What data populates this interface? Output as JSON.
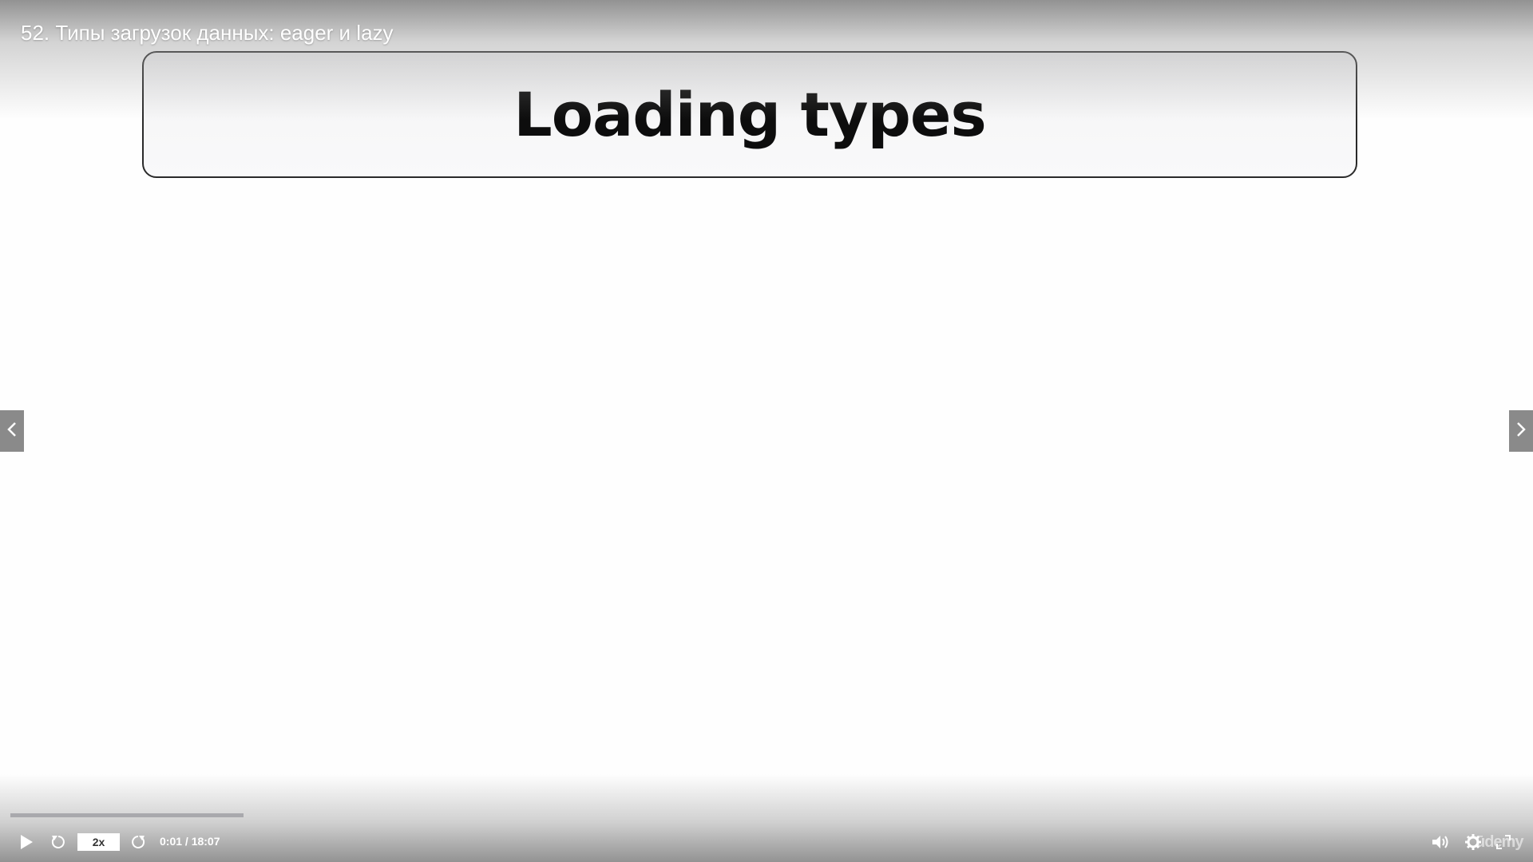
{
  "lecture": {
    "title": "52. Типы загрузок данных: eager и lazy"
  },
  "slide": {
    "title": "Loading types"
  },
  "player": {
    "speed_label": "2x",
    "current_time": "0:01",
    "duration": "18:07",
    "time_display": "0:01 / 18:07",
    "progress_fraction": 0.154,
    "watermark": "ūdemy"
  },
  "icons": {
    "prev": "chevron-left-icon",
    "next": "chevron-right-icon",
    "play": "play-icon",
    "rewind": "rewind-icon",
    "forward": "forward-icon",
    "volume": "volume-icon",
    "settings": "gear-icon",
    "fullscreen": "expand-icon"
  },
  "colors": {
    "nav_arrow_bg": "#8a8a8a",
    "progress_fill": "#a9a9ad",
    "slide_border": "#2a2a2a"
  }
}
